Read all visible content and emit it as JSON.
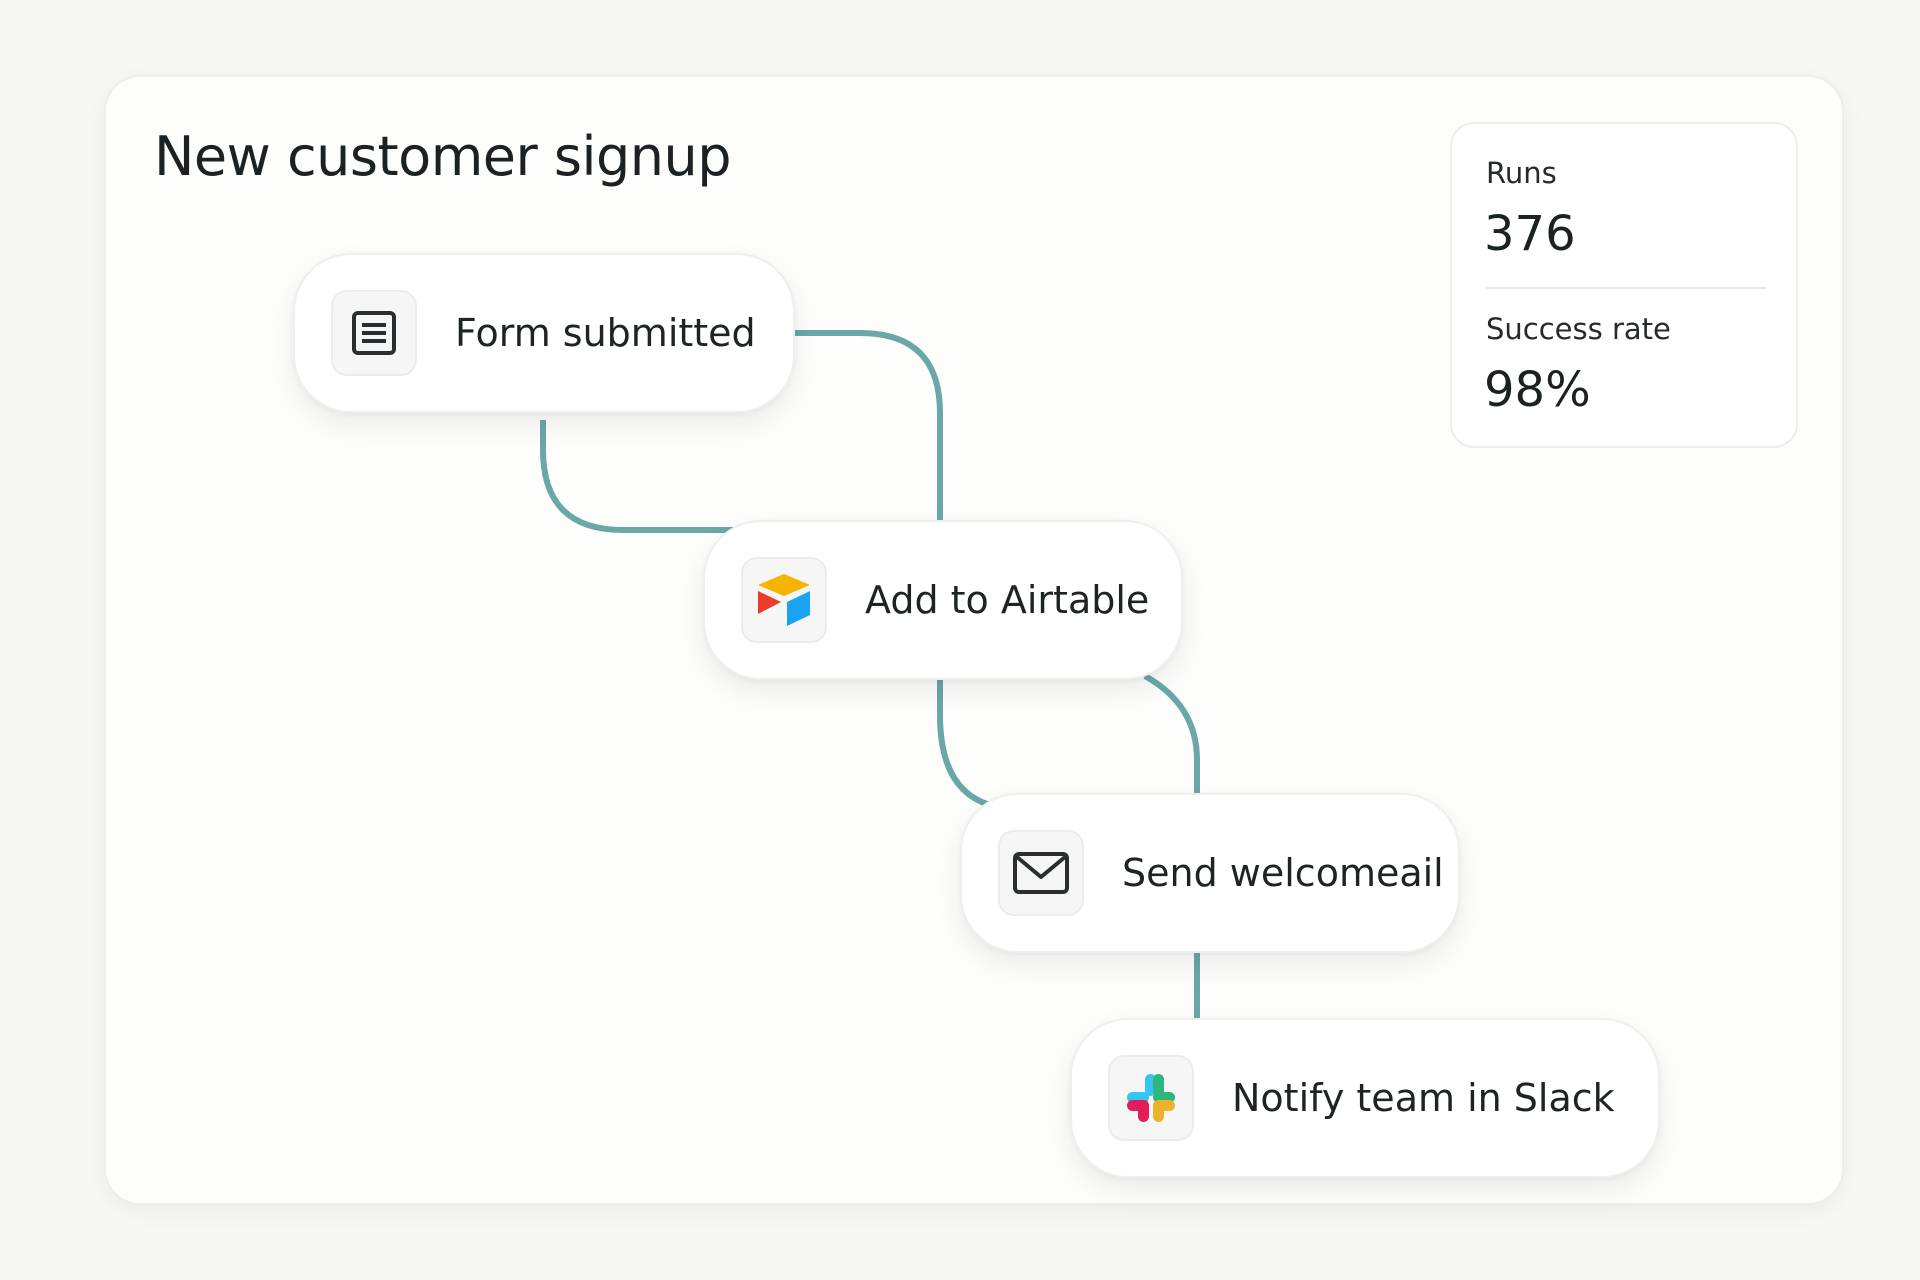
{
  "workflow": {
    "title": "New customer signup"
  },
  "steps": [
    {
      "label": "Form submitted",
      "icon": "form-icon"
    },
    {
      "label": "Add to Airtable",
      "icon": "airtable-icon"
    },
    {
      "label": "Send welcomeail",
      "icon": "mail-icon"
    },
    {
      "label": "Notify team in Slack",
      "icon": "slack-icon"
    }
  ],
  "stats": {
    "runs_label": "Runs",
    "runs_value": "376",
    "success_label": "Success rate",
    "success_value": "98%"
  },
  "colors": {
    "connector": "#6aa7a8",
    "airtable_yellow": "#f5b400",
    "airtable_red": "#ef3b2c",
    "airtable_blue": "#18a4f0",
    "slack_blue": "#36c5f0",
    "slack_green": "#2eb67d",
    "slack_yellow": "#ecb22e",
    "slack_red": "#e01e5a"
  }
}
